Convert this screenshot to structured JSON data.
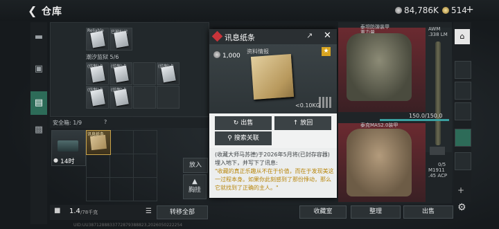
{
  "header": {
    "title": "仓库",
    "silver": "84,786K",
    "gold": "514",
    "plus": "+"
  },
  "left_grid": {
    "cells": [
      {
        "caption": "Reliable"
      },
      {
        "caption": "已被标记"
      },
      {
        "caption": "(仿制)卡"
      },
      {
        "caption": "(仿制)卡"
      },
      {
        "caption": "(仿制)卡"
      },
      {
        "caption": "(仿制)卡"
      },
      {
        "caption": "(仿制)卡"
      },
      {
        "caption": "(仿制)卡"
      }
    ],
    "section_label": "潮汐监狱 5/6"
  },
  "safe": {
    "label": "安全箱: 1/9",
    "help": "?",
    "timer": "14时",
    "note_caption": "讯息纸条"
  },
  "side_buttons": {
    "put_in": "放入",
    "lock_label": "胸挂"
  },
  "bottom": {
    "capacity": "1.4",
    "capacity_unit": "/78千克",
    "transfer": "转移全部"
  },
  "popup": {
    "title": "讯息纸条",
    "price": "1,000",
    "category": "资料情报",
    "weight": "<0.10KG",
    "sell": "出售",
    "release": "放回",
    "search": "搜索关联",
    "desc_intro": "(收藏大师马苏德)于2026年5月将(已封存容器)埋入地下，并写下了讯息:",
    "desc_quote": "\"收藏的真正乐趣从不在于价值，而在于发现美这一过程本身。如果你此刻感到了那份悸动，那么它就找到了正确的主人。\""
  },
  "right": {
    "armor1_label": "泰坦防弹装甲",
    "armor1_sub": "重力量",
    "gun1": "AWM",
    "gun1_sub": ".338 LM",
    "durability": "150.0/150.0",
    "armor2_label": "泰克MAS2.0装甲",
    "gun2": "M1911",
    "gun2_sub": ".45 ACP",
    "ammo": "0/5"
  },
  "footer": {
    "collection": "收藏室",
    "organize": "整理",
    "sell": "出售"
  },
  "status_line": "UID:UU3871288833772879388823,2026050222254"
}
